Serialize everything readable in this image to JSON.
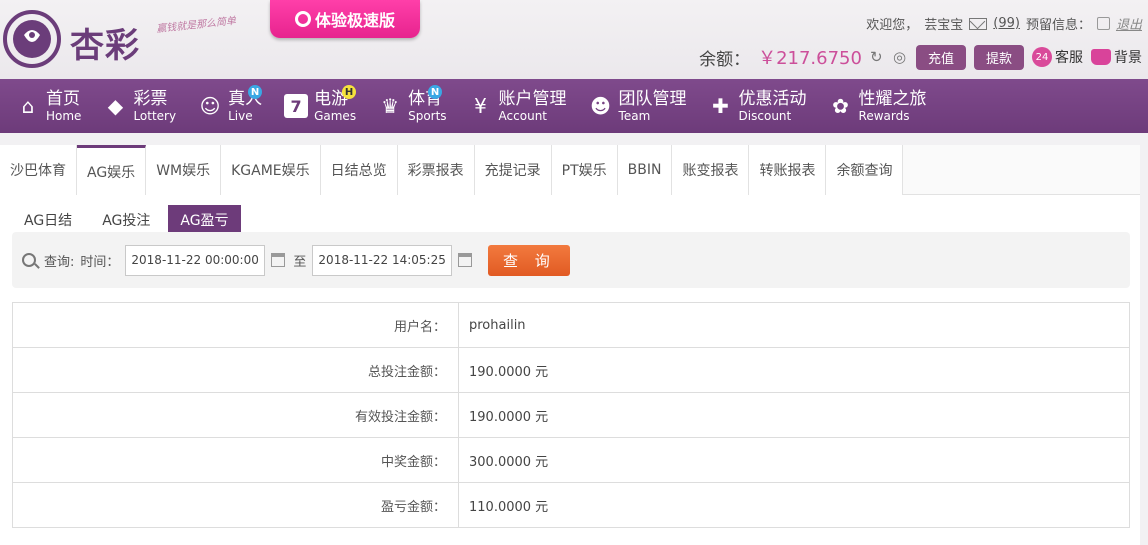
{
  "header": {
    "logo_text": "杏彩",
    "slogan": "赢钱就是那么简单",
    "speed_button": "体验极速版",
    "welcome": "欢迎您，",
    "username": "芸宝宝",
    "mail_count": "(99)",
    "notice": "预留信息：",
    "logout": "退出",
    "balance_label": "余额：",
    "balance_value": "￥217.6750",
    "deposit": "充值",
    "withdraw": "提款",
    "service_badge": "24",
    "service": "客服",
    "background": "背景"
  },
  "nav": [
    {
      "cn": "首页",
      "en": "Home",
      "icon": "home-icon"
    },
    {
      "cn": "彩票",
      "en": "Lottery",
      "icon": "lottery-icon"
    },
    {
      "cn": "真人",
      "en": "Live",
      "icon": "live-icon",
      "badge": "N"
    },
    {
      "cn": "电游",
      "en": "Games",
      "icon": "games-icon",
      "badge": "H"
    },
    {
      "cn": "体育",
      "en": "Sports",
      "icon": "trophy-icon",
      "badge": "N"
    },
    {
      "cn": "账户管理",
      "en": "Account",
      "icon": "account-icon"
    },
    {
      "cn": "团队管理",
      "en": "Team",
      "icon": "team-icon"
    },
    {
      "cn": "优惠活动",
      "en": "Discount",
      "icon": "gift-icon"
    },
    {
      "cn": "性耀之旅",
      "en": "Rewards",
      "icon": "rewards-icon"
    }
  ],
  "tabs": [
    "沙巴体育",
    "AG娱乐",
    "WM娱乐",
    "KGAME娱乐",
    "日结总览",
    "彩票报表",
    "充提记录",
    "PT娱乐",
    "BBIN",
    "账变报表",
    "转账报表",
    "余额查询"
  ],
  "subtabs": [
    "AG日结",
    "AG投注",
    "AG盈亏"
  ],
  "query": {
    "label": "查询:",
    "time_label": "时间：",
    "start": "2018-11-22 00:00:00",
    "to": "至",
    "end": "2018-11-22 14:05:25",
    "button": "查 询"
  },
  "result": [
    {
      "k": "用户名：",
      "v": "prohailin"
    },
    {
      "k": "总投注金额：",
      "v": "190.0000 元"
    },
    {
      "k": "有效投注金额：",
      "v": "190.0000 元"
    },
    {
      "k": "中奖金额：",
      "v": "300.0000 元"
    },
    {
      "k": "盈亏金额：",
      "v": "110.0000 元"
    }
  ],
  "colors": {
    "brand": "#6d3b7a",
    "accent": "#cc4f9a",
    "button": "#e15a23"
  }
}
